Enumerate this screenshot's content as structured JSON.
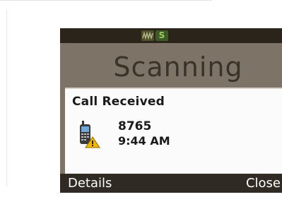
{
  "status_bar": {
    "icons": [
      "wave-icon",
      "s-icon"
    ],
    "s_icon_label": "S"
  },
  "screen": {
    "title": "Scanning"
  },
  "popup": {
    "title": "Call Received",
    "icon": "phone-warning-icon",
    "number": "8765",
    "time": "9:44 AM"
  },
  "softkeys": {
    "left": "Details",
    "right": "Close"
  },
  "colors": {
    "screen_bg": "#7d7467",
    "bar_bg": "#2a241b",
    "popup_bg": "#fbfbfb",
    "accent_green": "#97d05f",
    "warning_yellow": "#f2b705"
  }
}
